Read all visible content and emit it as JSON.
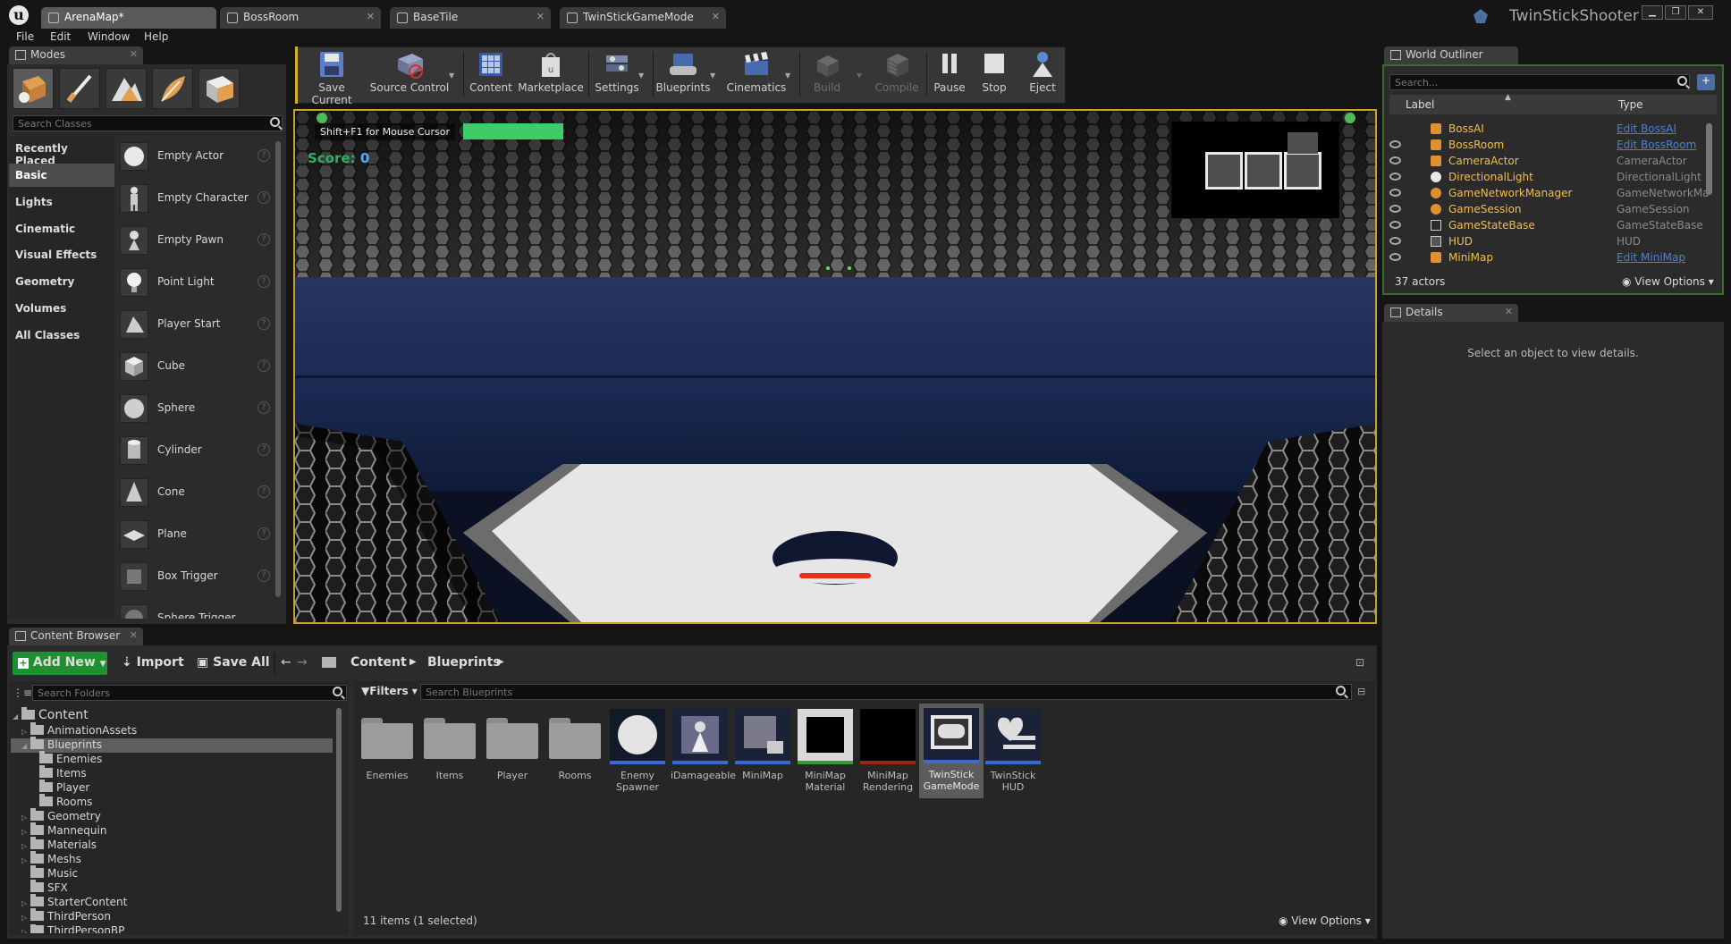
{
  "tabs": [
    {
      "label": "ArenaMap*"
    },
    {
      "label": "BossRoom"
    },
    {
      "label": "BaseTile"
    },
    {
      "label": "TwinStickGameMode"
    }
  ],
  "project_name": "TwinStickShooter",
  "menu": [
    "File",
    "Edit",
    "Window",
    "Help"
  ],
  "modes": {
    "tab_label": "Modes",
    "search_placeholder": "Search Classes",
    "categories": [
      "Recently Placed",
      "Basic",
      "Lights",
      "Cinematic",
      "Visual Effects",
      "Geometry",
      "Volumes",
      "All Classes"
    ],
    "items": [
      "Empty Actor",
      "Empty Character",
      "Empty Pawn",
      "Point Light",
      "Player Start",
      "Cube",
      "Sphere",
      "Cylinder",
      "Cone",
      "Plane",
      "Box Trigger",
      "Sphere Trigger"
    ]
  },
  "toolbar": {
    "buttons": [
      "Save Current",
      "Source Control",
      "Content",
      "Marketplace",
      "Settings",
      "Blueprints",
      "Cinematics",
      "Build",
      "Compile",
      "Pause",
      "Stop",
      "Eject"
    ]
  },
  "viewport": {
    "hint": "Shift+F1 for Mouse Cursor",
    "score_label": "Score:",
    "score_value": "0",
    "health_fraction": 1.0
  },
  "outliner": {
    "tab_label": "World Outliner",
    "search_placeholder": "Search...",
    "col_label": "Label",
    "col_type": "Type",
    "rows": [
      {
        "label": "BossAI",
        "type": "Edit BossAI",
        "link": true
      },
      {
        "label": "BossRoom",
        "type": "Edit BossRoom",
        "link": true
      },
      {
        "label": "CameraActor",
        "type": "CameraActor",
        "link": false
      },
      {
        "label": "DirectionalLight",
        "type": "DirectionalLight",
        "link": false
      },
      {
        "label": "GameNetworkManager",
        "type": "GameNetworkMar",
        "link": false
      },
      {
        "label": "GameSession",
        "type": "GameSession",
        "link": false
      },
      {
        "label": "GameStateBase",
        "type": "GameStateBase",
        "link": false
      },
      {
        "label": "HUD",
        "type": "HUD",
        "link": false
      },
      {
        "label": "MiniMap",
        "type": "Edit MiniMap",
        "link": true
      }
    ],
    "count": "37 actors",
    "view_options": "View Options"
  },
  "details": {
    "tab_label": "Details",
    "empty_text": "Select an object to view details."
  },
  "content_browser": {
    "tab_label": "Content Browser",
    "add_new": "Add New",
    "import": "Import",
    "save_all": "Save All",
    "path": [
      "Content",
      "Blueprints"
    ],
    "folder_search_placeholder": "Search Folders",
    "filters_label": "Filters",
    "asset_search_placeholder": "Search Blueprints",
    "tree": {
      "root": "Content",
      "items": [
        "AnimationAssets",
        "Blueprints",
        "Enemies",
        "Items",
        "Player",
        "Rooms",
        "Geometry",
        "Mannequin",
        "Materials",
        "Meshs",
        "Music",
        "SFX",
        "StarterContent",
        "ThirdPerson",
        "ThirdPersonBP"
      ]
    },
    "assets": [
      {
        "name": "Enemies"
      },
      {
        "name": "Items"
      },
      {
        "name": "Player"
      },
      {
        "name": "Rooms"
      },
      {
        "name": "Enemy Spawner"
      },
      {
        "name": "iDamageable"
      },
      {
        "name": "MiniMap"
      },
      {
        "name": "MiniMap Material"
      },
      {
        "name": "MiniMap Rendering"
      },
      {
        "name": "TwinStick GameMode"
      },
      {
        "name": "TwinStick HUD"
      }
    ],
    "status": "11 items (1 selected)",
    "view_options": "View Options"
  }
}
